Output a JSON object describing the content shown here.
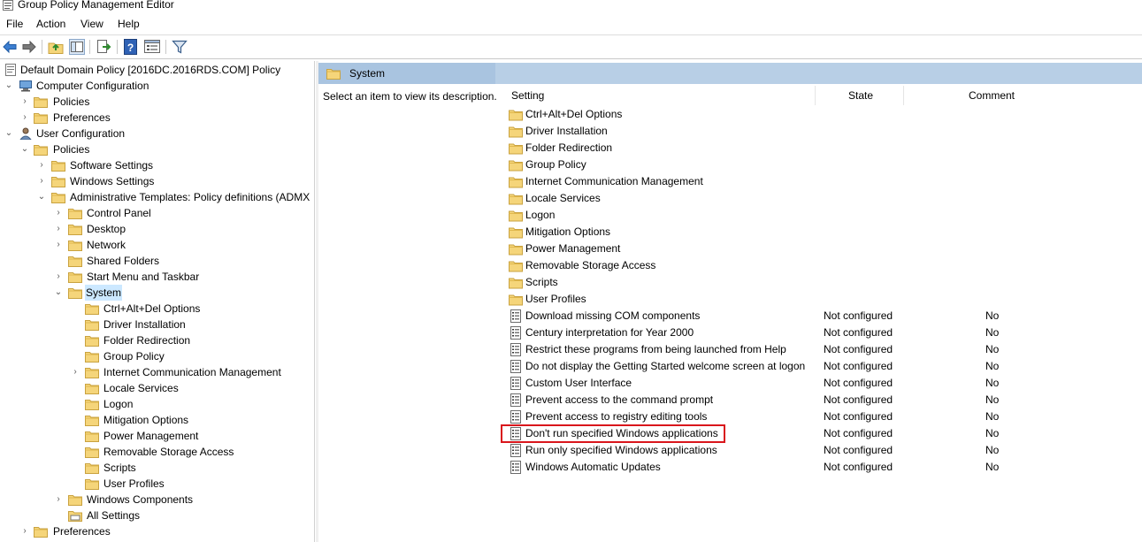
{
  "window": {
    "title": "Group Policy Management Editor"
  },
  "menu": {
    "items": [
      "File",
      "Action",
      "View",
      "Help"
    ]
  },
  "toolbar": {
    "buttons": [
      "back-icon",
      "forward-icon",
      "up-folder-icon",
      "show-hide-tree-icon",
      "export-list-icon",
      "help-icon",
      "properties-icon",
      "filter-icon"
    ]
  },
  "tree": {
    "root": "Default Domain Policy [2016DC.2016RDS.COM] Policy",
    "computer_configuration": "Computer Configuration",
    "cc_policies": "Policies",
    "cc_preferences": "Preferences",
    "user_configuration": "User Configuration",
    "uc_policies": "Policies",
    "software_settings": "Software Settings",
    "windows_settings": "Windows Settings",
    "admin_templates": "Administrative Templates: Policy definitions (ADMX",
    "control_panel": "Control Panel",
    "desktop": "Desktop",
    "network": "Network",
    "shared_folders": "Shared Folders",
    "start_menu": "Start Menu and Taskbar",
    "system": "System",
    "system_children": [
      "Ctrl+Alt+Del Options",
      "Driver Installation",
      "Folder Redirection",
      "Group Policy",
      "Internet Communication Management",
      "Locale Services",
      "Logon",
      "Mitigation Options",
      "Power Management",
      "Removable Storage Access",
      "Scripts",
      "User Profiles"
    ],
    "windows_components": "Windows Components",
    "all_settings": "All Settings",
    "uc_preferences": "Preferences"
  },
  "panel": {
    "header_title": "System",
    "description": "Select an item to view its description."
  },
  "list": {
    "columns": {
      "setting": "Setting",
      "state": "State",
      "comment": "Comment"
    },
    "folders": [
      "Ctrl+Alt+Del Options",
      "Driver Installation",
      "Folder Redirection",
      "Group Policy",
      "Internet Communication Management",
      "Locale Services",
      "Logon",
      "Mitigation Options",
      "Power Management",
      "Removable Storage Access",
      "Scripts",
      "User Profiles"
    ],
    "settings": [
      {
        "name": "Download missing COM components",
        "state": "Not configured",
        "comment": "No"
      },
      {
        "name": "Century interpretation for Year 2000",
        "state": "Not configured",
        "comment": "No"
      },
      {
        "name": "Restrict these programs from being launched from Help",
        "state": "Not configured",
        "comment": "No"
      },
      {
        "name": "Do not display the Getting Started welcome screen at logon",
        "state": "Not configured",
        "comment": "No"
      },
      {
        "name": "Custom User Interface",
        "state": "Not configured",
        "comment": "No"
      },
      {
        "name": "Prevent access to the command prompt",
        "state": "Not configured",
        "comment": "No"
      },
      {
        "name": "Prevent access to registry editing tools",
        "state": "Not configured",
        "comment": "No"
      },
      {
        "name": "Don't run specified Windows applications",
        "state": "Not configured",
        "comment": "No"
      },
      {
        "name": "Run only specified Windows applications",
        "state": "Not configured",
        "comment": "No"
      },
      {
        "name": "Windows Automatic Updates",
        "state": "Not configured",
        "comment": "No"
      }
    ]
  },
  "colors": {
    "highlight_border": "#d9161c",
    "selection_bg": "#cce8ff",
    "header_bg": "#b8cfe6",
    "folder": "#e8c46a"
  }
}
